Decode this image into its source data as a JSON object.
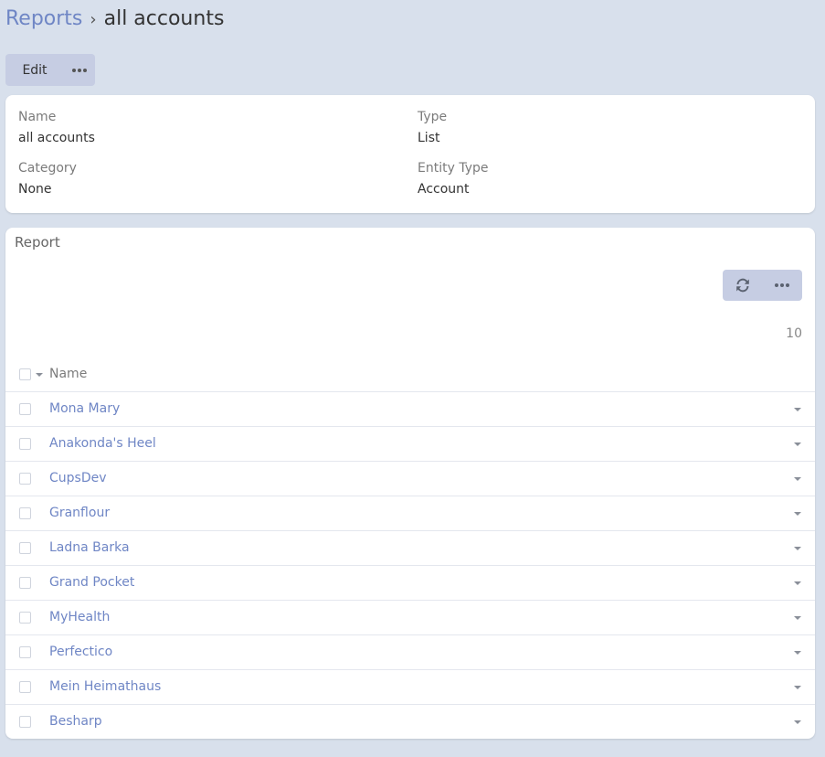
{
  "breadcrumb": {
    "parent": "Reports",
    "separator": "›",
    "current": "all accounts"
  },
  "actions": {
    "edit_label": "Edit"
  },
  "details": {
    "name_label": "Name",
    "name_value": "all accounts",
    "type_label": "Type",
    "type_value": "List",
    "category_label": "Category",
    "category_value": "None",
    "entity_type_label": "Entity Type",
    "entity_type_value": "Account"
  },
  "report": {
    "title": "Report",
    "count": "10",
    "column_name": "Name",
    "rows": [
      "Mona Mary",
      "Anakonda's Heel",
      "CupsDev",
      "Granflour",
      "Ladna Barka",
      "Grand Pocket",
      "MyHealth",
      "Perfectico",
      "Mein Heimathaus",
      "Besharp"
    ]
  },
  "colors": {
    "link": "#6f86c5",
    "background": "#d8e0ec",
    "button": "#c6cde3"
  },
  "icons": {
    "refresh": "refresh-icon",
    "more": "ellipsis-icon",
    "row_menu": "caret-down-icon"
  }
}
